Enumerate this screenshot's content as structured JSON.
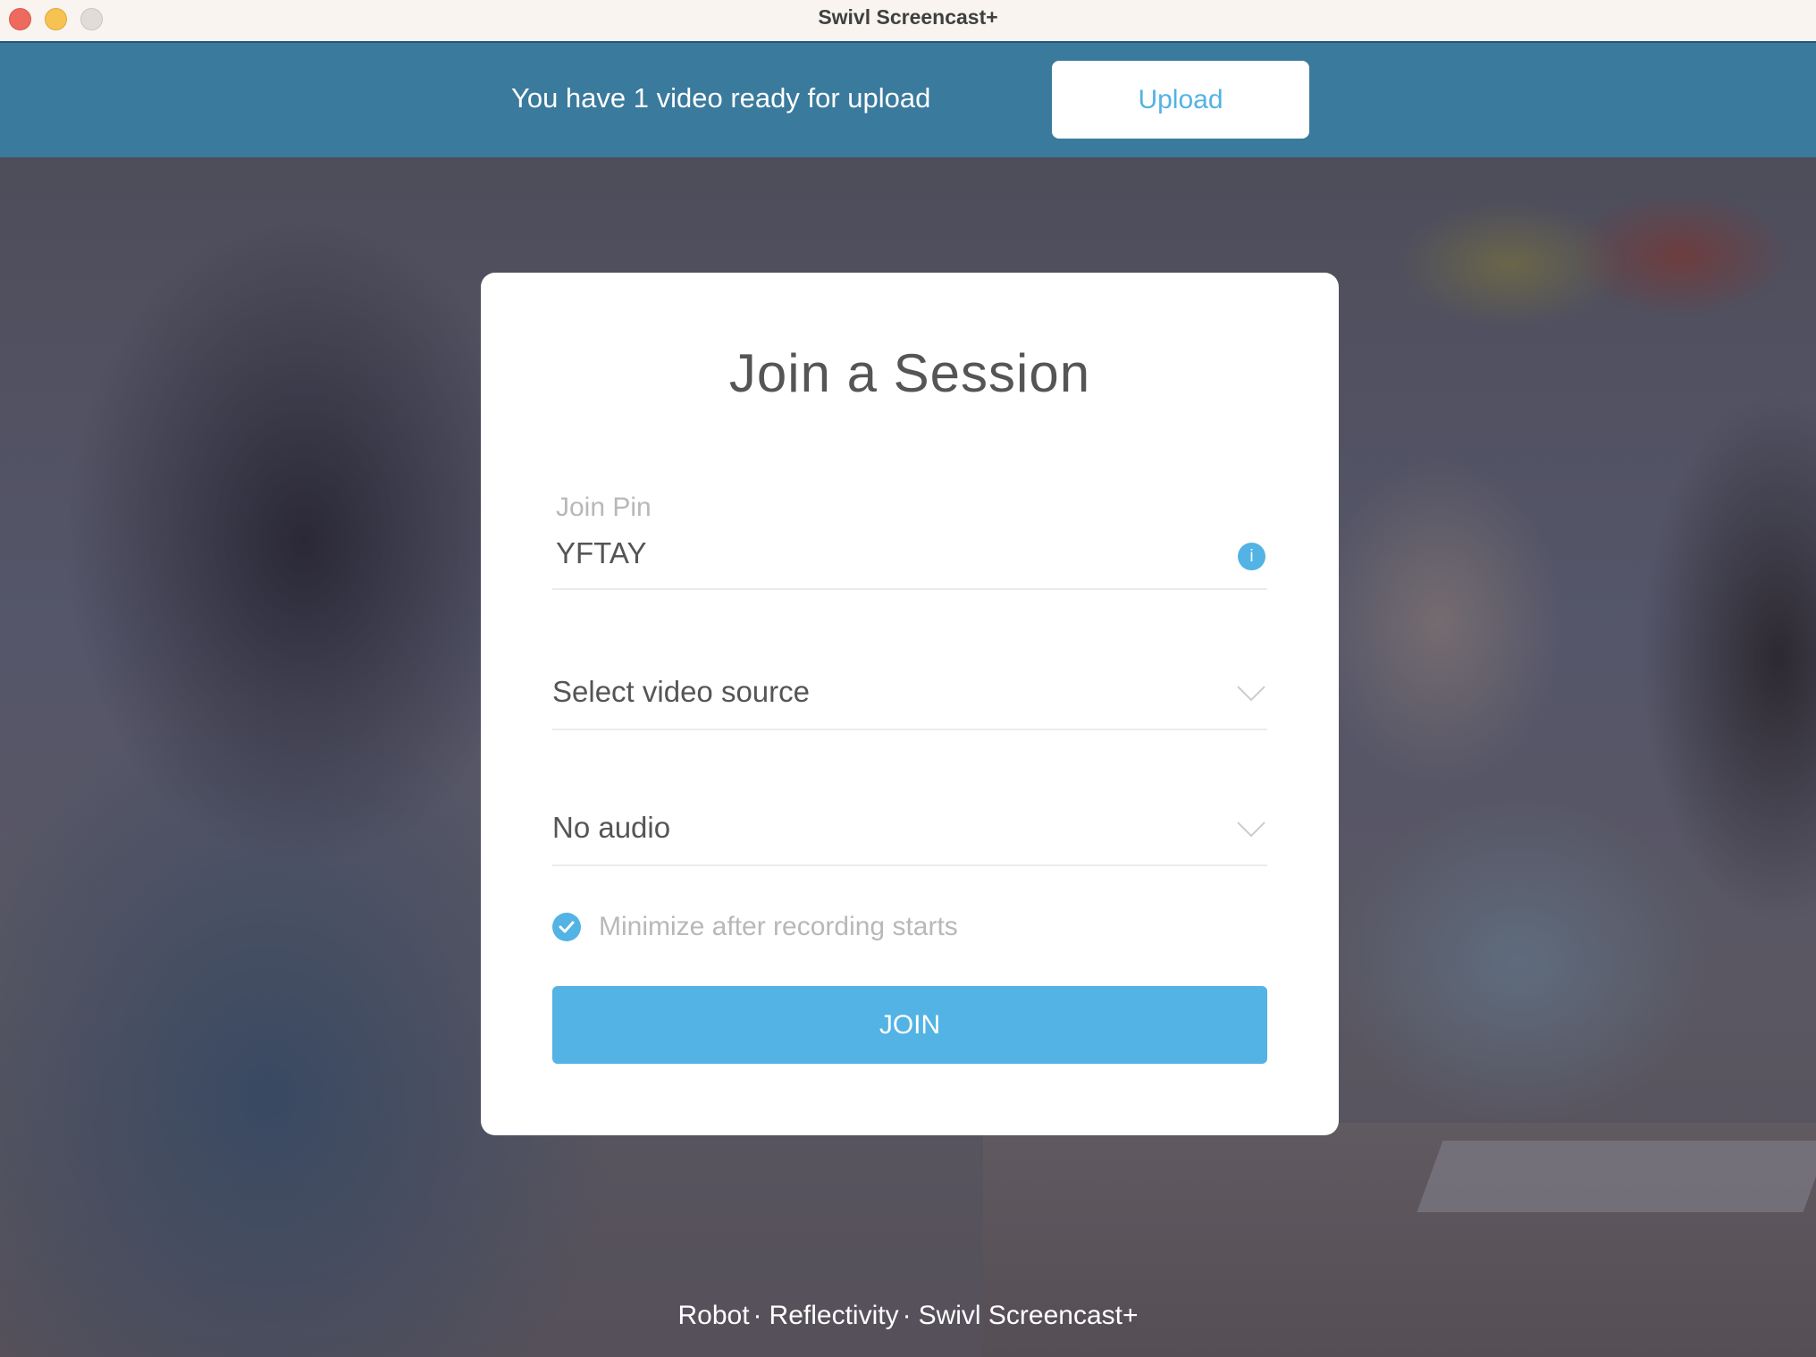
{
  "window": {
    "title": "Swivl Screencast+",
    "controls": [
      "close",
      "minimize",
      "maximize"
    ]
  },
  "banner": {
    "message": "You have 1 video ready for upload",
    "upload_label": "Upload"
  },
  "card": {
    "title": "Join a Session",
    "join_pin": {
      "label": "Join Pin",
      "value": "YFTAY",
      "info_icon": "info-icon",
      "info_glyph": "i"
    },
    "video_source": {
      "selected": "Select video source",
      "icon": "chevron-down-icon"
    },
    "audio_source": {
      "selected": "No audio",
      "icon": "chevron-down-icon"
    },
    "minimize_option": {
      "label": "Minimize after recording starts",
      "checked": true
    },
    "join_label": "JOIN"
  },
  "footer": {
    "links": [
      "Robot",
      "Reflectivity",
      "Swivl Screencast+"
    ],
    "separator": "·"
  },
  "colors": {
    "accent": "#52b3e4",
    "banner": "#3a7a9c",
    "titlebar": "#f9f4ef"
  }
}
